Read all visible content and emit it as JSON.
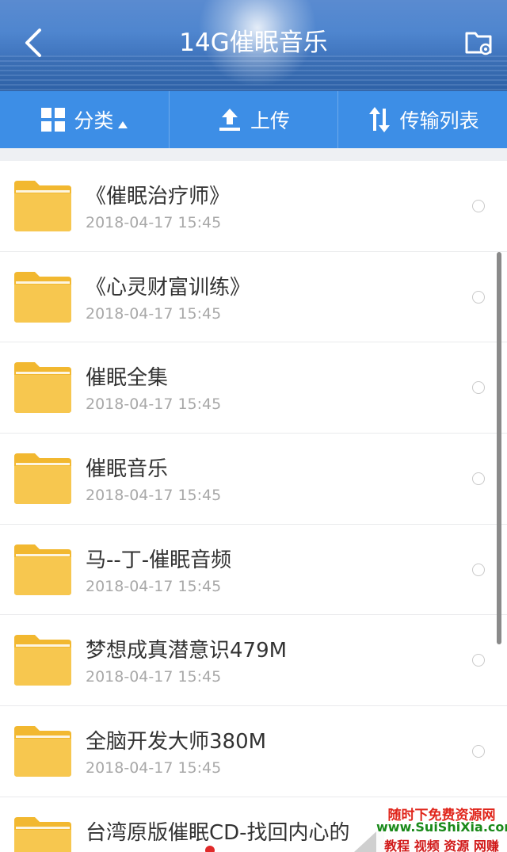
{
  "header": {
    "title": "14G催眠音乐",
    "back_icon": "chevron-left-icon",
    "settings_icon": "folder-settings-icon"
  },
  "toolbar": {
    "category_label": "分类",
    "upload_label": "上传",
    "transfer_label": "传输列表"
  },
  "files": [
    {
      "name": "《催眠治疗师》",
      "date": "2018-04-17  15:45"
    },
    {
      "name": "《心灵财富训练》",
      "date": "2018-04-17  15:45"
    },
    {
      "name": "催眠全集",
      "date": "2018-04-17  15:45"
    },
    {
      "name": "催眠音乐",
      "date": "2018-04-17  15:45"
    },
    {
      "name": "马--丁-催眠音频",
      "date": "2018-04-17  15:45"
    },
    {
      "name": "梦想成真潜意识479M",
      "date": "2018-04-17  15:45"
    },
    {
      "name": "全脑开发大师380M",
      "date": "2018-04-17  15:45"
    },
    {
      "name": "台湾原版催眠CD-找回内心的",
      "date": ""
    }
  ],
  "watermark": {
    "line1": "随时下免费资源网",
    "line2": "www.SuiShiXia.com",
    "line3": "教程 视频 资源 网赚"
  },
  "colors": {
    "toolbar_blue": "#3d8ee6",
    "folder_yellow": "#f7c74f"
  }
}
